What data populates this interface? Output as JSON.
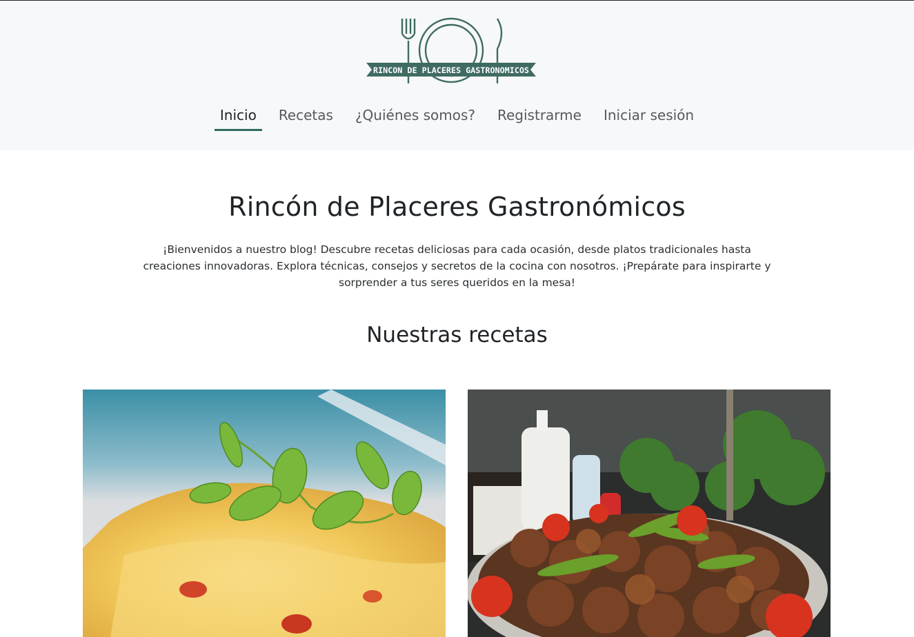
{
  "header": {
    "logo_text": "RINCON DE PLACERES GASTRONOMICOS",
    "nav": [
      {
        "label": "Inicio",
        "active": true
      },
      {
        "label": "Recetas",
        "active": false
      },
      {
        "label": "¿Quiénes somos?",
        "active": false
      },
      {
        "label": "Registrarme",
        "active": false
      },
      {
        "label": "Iniciar sesión",
        "active": false
      }
    ]
  },
  "main": {
    "title": "Rincón de Placeres Gastronómicos",
    "intro": "¡Bienvenidos a nuestro blog! Descubre recetas deliciosas para cada ocasión, desde platos tradicionales hasta creaciones innovadoras. Explora técnicas, consejos y secretos de la cocina con nosotros. ¡Prepárate para inspirarte y sorprender a tus seres queridos en la mesa!",
    "recipes_heading": "Nuestras recetas"
  },
  "colors": {
    "accent": "#2f6b60",
    "header_bg": "#f7f8f9"
  },
  "icons": {
    "logo": "fork-plate-knife-icon"
  }
}
